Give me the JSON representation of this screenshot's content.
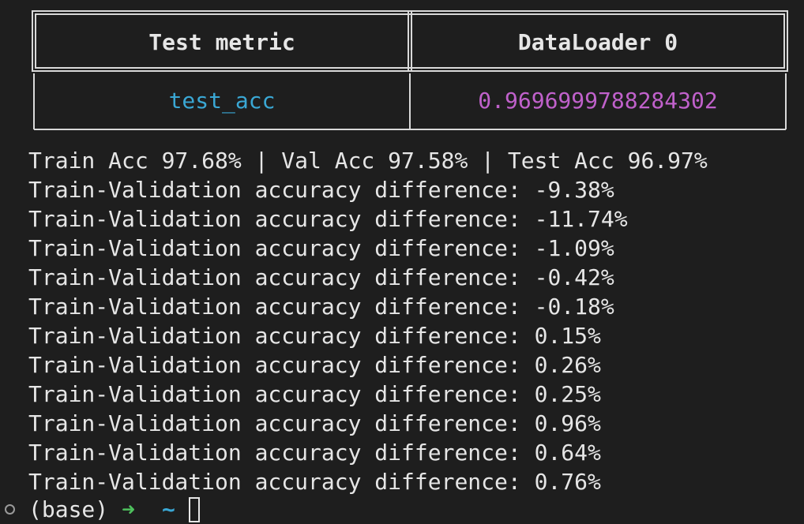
{
  "table": {
    "headers": [
      "Test metric",
      "DataLoader 0"
    ],
    "rows": [
      [
        "test_acc",
        "0.9696999788284302"
      ]
    ]
  },
  "summary_line": "Train Acc 97.68% | Val Acc 97.58% | Test Acc 96.97%",
  "diff_lines": [
    "Train-Validation accuracy difference: -9.38%",
    "Train-Validation accuracy difference: -11.74%",
    "Train-Validation accuracy difference: -1.09%",
    "Train-Validation accuracy difference: -0.42%",
    "Train-Validation accuracy difference: -0.18%",
    "Train-Validation accuracy difference: 0.15%",
    "Train-Validation accuracy difference: 0.26%",
    "Train-Validation accuracy difference: 0.25%",
    "Train-Validation accuracy difference: 0.96%",
    "Train-Validation accuracy difference: 0.64%",
    "Train-Validation accuracy difference: 0.76%"
  ],
  "prompt": {
    "env": "(base)",
    "arrow": "➜",
    "cwd": "~"
  },
  "colors": {
    "background": "#1e1e1e",
    "text": "#e6e6e6",
    "metric_name": "#3aa7d4",
    "metric_value": "#c061cb",
    "prompt_arrow": "#4ec15d",
    "border": "#d9d9d9"
  }
}
